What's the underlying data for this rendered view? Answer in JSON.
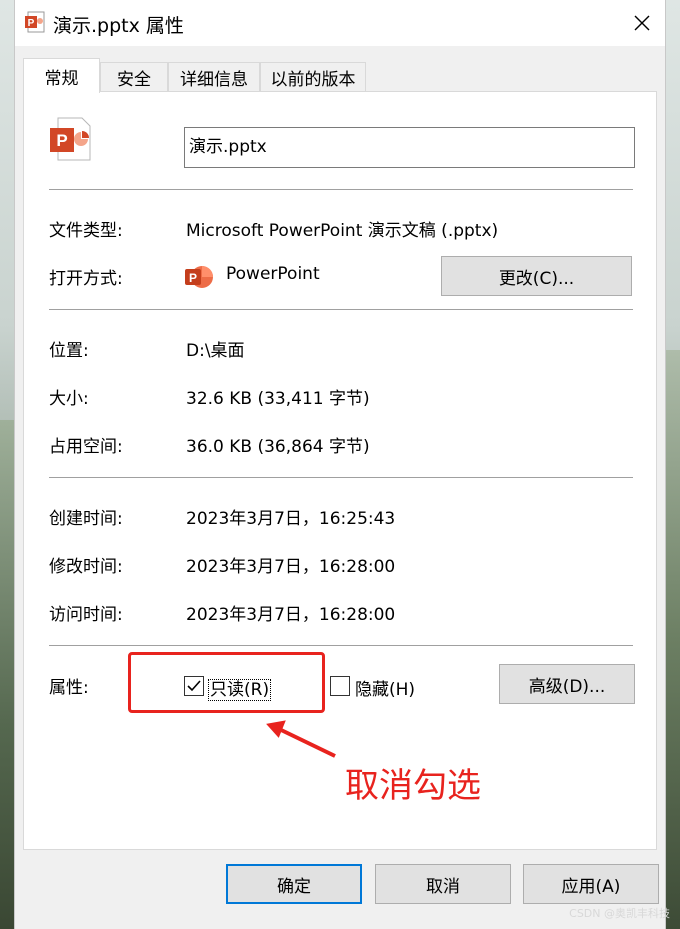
{
  "window": {
    "title": "演示.pptx 属性",
    "close_glyph": "✕"
  },
  "tabs": [
    {
      "label": "常规",
      "active": true
    },
    {
      "label": "安全",
      "active": false
    },
    {
      "label": "详细信息",
      "active": false
    },
    {
      "label": "以前的版本",
      "active": false
    }
  ],
  "general": {
    "filename": "演示.pptx",
    "file_type_label": "文件类型:",
    "file_type_value": "Microsoft PowerPoint 演示文稿 (.pptx)",
    "open_with_label": "打开方式:",
    "open_with_value": "PowerPoint",
    "change_button": "更改(C)...",
    "location_label": "位置:",
    "location_value": "D:\\桌面",
    "size_label": "大小:",
    "size_value": "32.6 KB (33,411 字节)",
    "size_on_disk_label": "占用空间:",
    "size_on_disk_value": "36.0 KB (36,864 字节)",
    "created_label": "创建时间:",
    "created_value": "2023年3月7日，16:25:43",
    "modified_label": "修改时间:",
    "modified_value": "2023年3月7日，16:28:00",
    "accessed_label": "访问时间:",
    "accessed_value": "2023年3月7日，16:28:00",
    "attributes_label": "属性:",
    "readonly_label": "只读(R)",
    "readonly_checked": true,
    "hidden_label": "隐藏(H)",
    "hidden_checked": false,
    "advanced_button": "高级(D)..."
  },
  "footer": {
    "ok_button": "确定",
    "cancel_button": "取消",
    "apply_button": "应用(A)"
  },
  "annotation": {
    "text": "取消勾选",
    "color": "#e8231e"
  },
  "watermark": "CSDN @奥凯丰科技",
  "colors": {
    "ppt_orange": "#d24726",
    "focus_blue": "#0078d7"
  }
}
